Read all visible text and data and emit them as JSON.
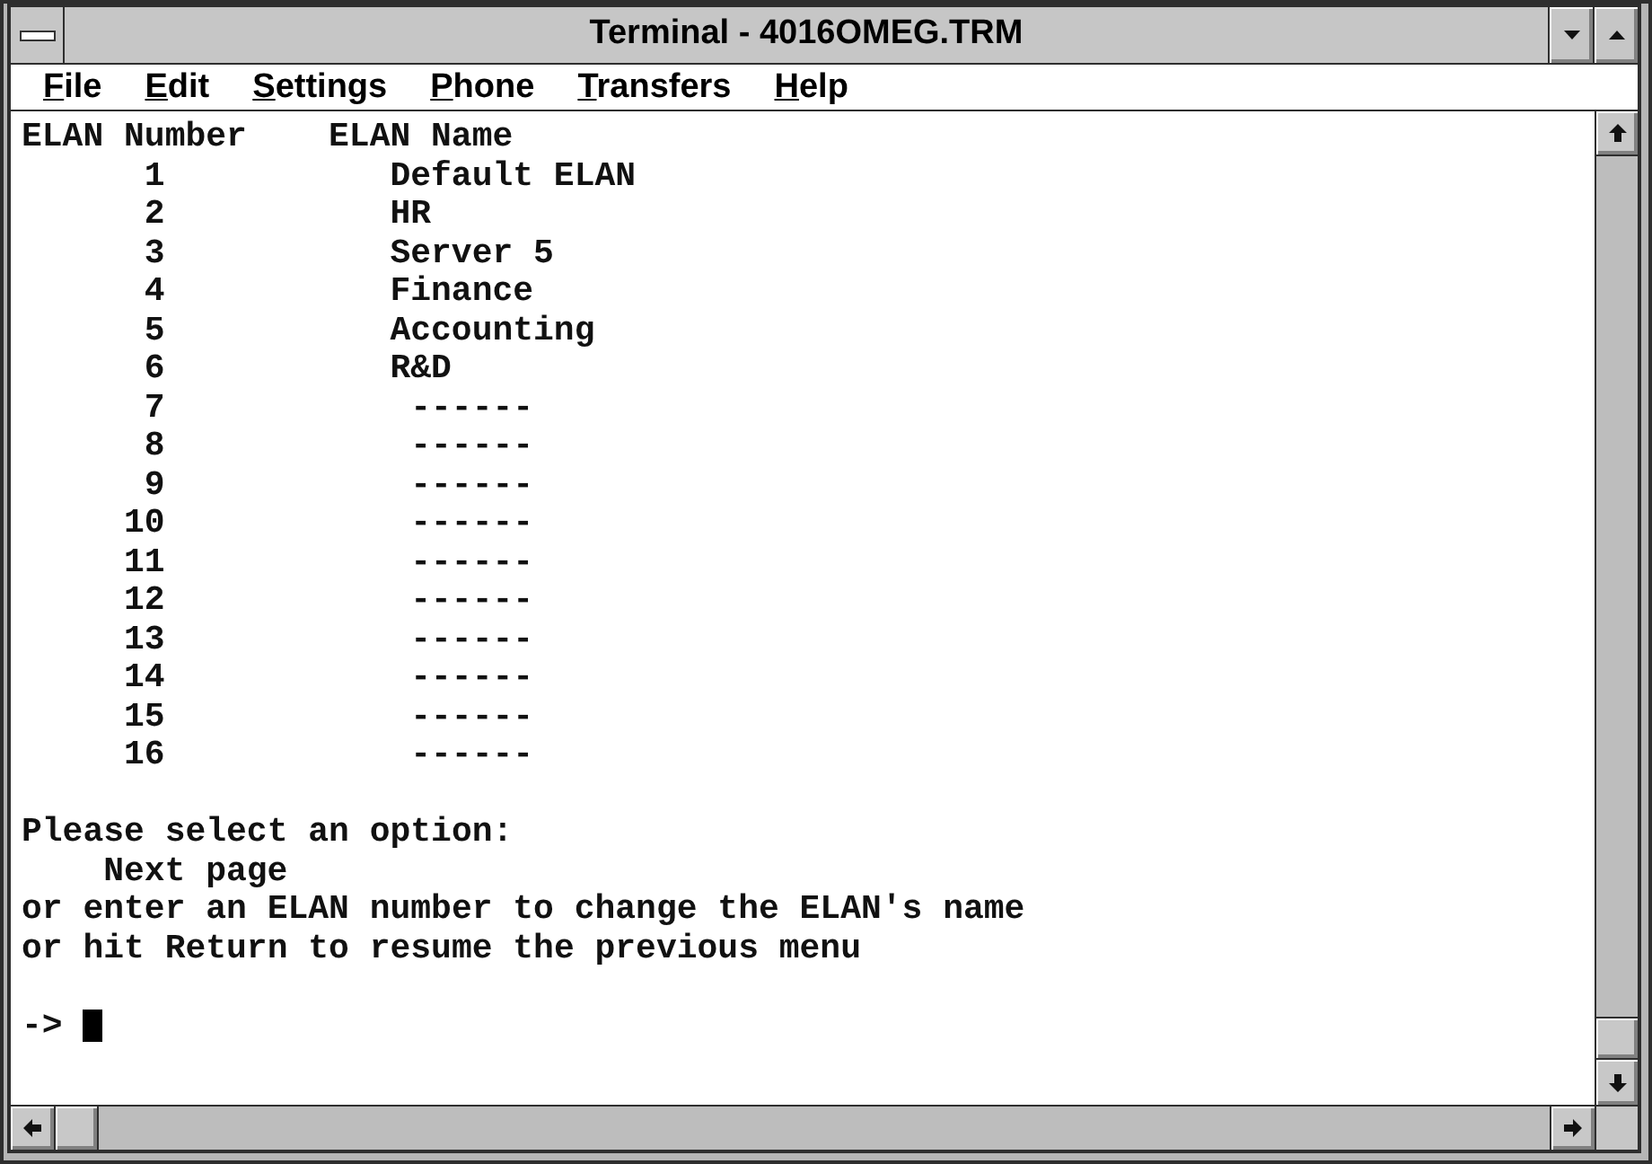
{
  "window": {
    "title": "Terminal - 4016OMEG.TRM"
  },
  "menu": [
    {
      "label": "File"
    },
    {
      "label": "Edit"
    },
    {
      "label": "Settings"
    },
    {
      "label": "Phone"
    },
    {
      "label": "Transfers"
    },
    {
      "label": "Help"
    }
  ],
  "terminal": {
    "columns": [
      "ELAN Number",
      "ELAN Name"
    ],
    "rows": [
      {
        "number": "1",
        "name": "Default ELAN",
        "kind": "named"
      },
      {
        "number": "2",
        "name": "HR",
        "kind": "named"
      },
      {
        "number": "3",
        "name": "Server 5",
        "kind": "named"
      },
      {
        "number": "4",
        "name": "Finance",
        "kind": "named"
      },
      {
        "number": "5",
        "name": "Accounting",
        "kind": "named"
      },
      {
        "number": "6",
        "name": "R&D",
        "kind": "named"
      },
      {
        "number": "7",
        "name": "------",
        "kind": "unnamed"
      },
      {
        "number": "8",
        "name": "------",
        "kind": "unnamed"
      },
      {
        "number": "9",
        "name": "------",
        "kind": "unnamed"
      },
      {
        "number": "10",
        "name": "------",
        "kind": "unnamed"
      },
      {
        "number": "11",
        "name": "------",
        "kind": "unnamed"
      },
      {
        "number": "12",
        "name": "------",
        "kind": "unnamed"
      },
      {
        "number": "13",
        "name": "------",
        "kind": "unnamed"
      },
      {
        "number": "14",
        "name": "------",
        "kind": "unnamed"
      },
      {
        "number": "15",
        "name": "------",
        "kind": "unnamed"
      },
      {
        "number": "16",
        "name": "------",
        "kind": "unnamed"
      }
    ],
    "prompt": {
      "heading": "Please select an option:",
      "options": [
        "Next page"
      ],
      "instructions": [
        "or enter an ELAN number to change the ELAN's name",
        "or hit Return to resume the previous menu"
      ],
      "input_prompt": "->"
    }
  }
}
